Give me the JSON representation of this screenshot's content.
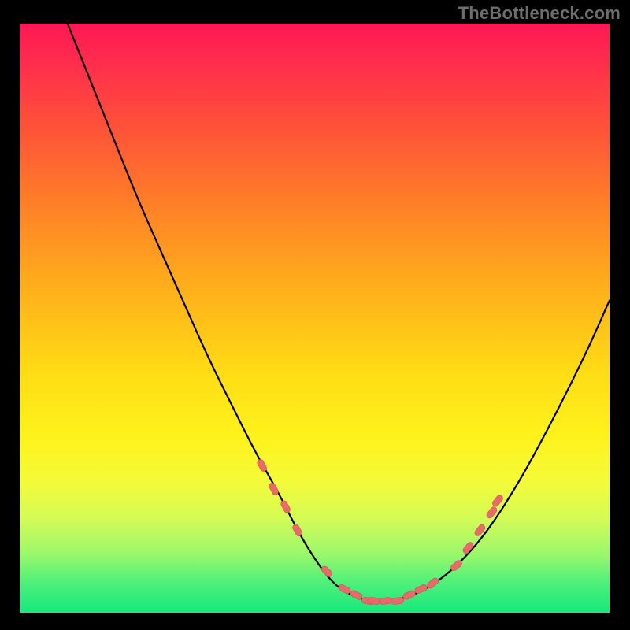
{
  "watermark": "TheBottleneck.com",
  "colors": {
    "page_bg": "#000000",
    "watermark_text": "#6d6d6d",
    "curve_stroke": "#000000",
    "marker_fill": "#e86a6a",
    "marker_stroke": "#d34f4f",
    "gradient_stops": [
      "#ff1854",
      "#ff2b4e",
      "#ff5338",
      "#ff8426",
      "#ffb31a",
      "#ffde15",
      "#fff21c",
      "#f3fb3a",
      "#d4fb56",
      "#9bf86b",
      "#4df07a",
      "#17e87d"
    ]
  },
  "chart_data": {
    "type": "line",
    "title": "",
    "xlabel": "",
    "ylabel": "",
    "xlim": [
      0,
      100
    ],
    "ylim": [
      0,
      100
    ],
    "grid": false,
    "legend": false,
    "series": [
      {
        "name": "bottleneck-curve",
        "x": [
          8,
          12,
          16,
          20,
          24,
          28,
          32,
          36,
          40,
          44,
          47,
          50,
          53,
          56,
          59,
          63,
          67,
          72,
          78,
          84,
          90,
          96,
          100
        ],
        "y": [
          100,
          90,
          80,
          70,
          61,
          52,
          43,
          35,
          27,
          20,
          14,
          9,
          5,
          3,
          2,
          2,
          3,
          6,
          12,
          21,
          32,
          44,
          53
        ]
      }
    ],
    "markers": {
      "name": "highlight-dots",
      "x": [
        41,
        43,
        45,
        47,
        52,
        55,
        57,
        59,
        60,
        62,
        64,
        66,
        68,
        70,
        74,
        76,
        78,
        80,
        81
      ],
      "y": [
        25,
        21,
        18,
        14,
        7,
        4,
        3,
        2,
        2,
        2,
        2,
        3,
        4,
        5,
        8,
        11,
        14,
        17,
        19
      ]
    },
    "background_gradient": {
      "direction": "top-to-bottom",
      "meaning": "high-bottleneck-red-to-low-bottleneck-green"
    }
  }
}
